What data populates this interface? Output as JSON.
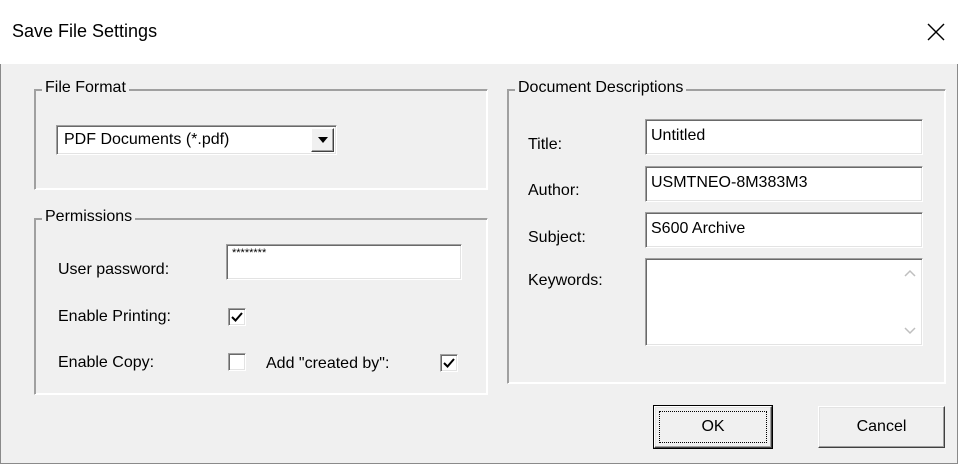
{
  "window": {
    "title": "Save File Settings"
  },
  "file_format": {
    "legend": "File Format",
    "selected": "PDF Documents (*.pdf)"
  },
  "permissions": {
    "legend": "Permissions",
    "user_password_label": "User password:",
    "user_password_value": "********",
    "enable_printing_label": "Enable Printing:",
    "enable_printing_checked": true,
    "enable_copy_label": "Enable Copy:",
    "enable_copy_checked": false,
    "created_by_label": "Add \"created by\":",
    "created_by_checked": true
  },
  "descriptions": {
    "legend": "Document Descriptions",
    "title_label": "Title:",
    "title_value": "Untitled",
    "author_label": "Author:",
    "author_value": "USMTNEO-8M383M3",
    "subject_label": "Subject:",
    "subject_value": "S600 Archive",
    "keywords_label": "Keywords:",
    "keywords_value": ""
  },
  "buttons": {
    "ok": "OK",
    "cancel": "Cancel"
  }
}
